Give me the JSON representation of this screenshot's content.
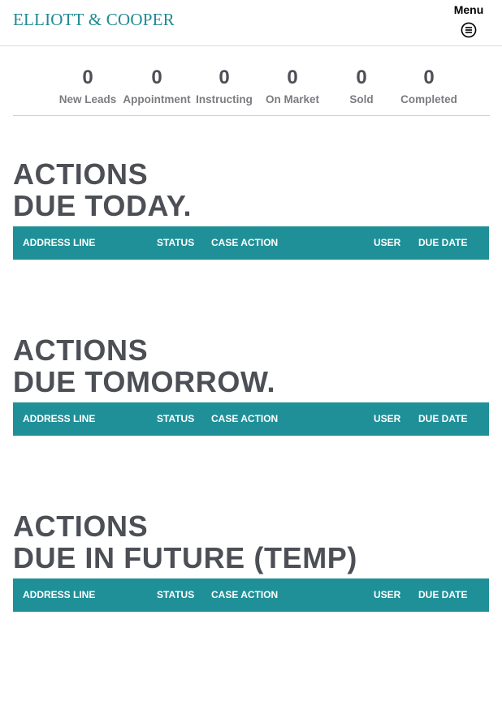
{
  "header": {
    "logo_text": "ELLIOTT & COOPER",
    "menu_label": "Menu",
    "menu_icon": "hamburger-circle-icon"
  },
  "stats": [
    {
      "value": "0",
      "label": "New Leads"
    },
    {
      "value": "0",
      "label": "Appointment"
    },
    {
      "value": "0",
      "label": "Instructing"
    },
    {
      "value": "0",
      "label": "On Market"
    },
    {
      "value": "0",
      "label": "Sold"
    },
    {
      "value": "0",
      "label": "Completed"
    }
  ],
  "sections": [
    {
      "title_line1": "ACTIONS",
      "title_line2": "DUE TODAY."
    },
    {
      "title_line1": "ACTIONS",
      "title_line2": "DUE TOMORROW."
    },
    {
      "title_line1": "ACTIONS",
      "title_line2": "DUE IN FUTURE (TEMP)"
    }
  ],
  "table_columns": [
    "ADDRESS LINE",
    "STATUS",
    "CASE ACTION",
    "USER",
    "DUE DATE"
  ],
  "colors": {
    "brand_teal": "#1f9098",
    "logo_teal": "#1f8a91",
    "heading_gray": "#4d4f56",
    "label_gray": "#7b7c80"
  }
}
